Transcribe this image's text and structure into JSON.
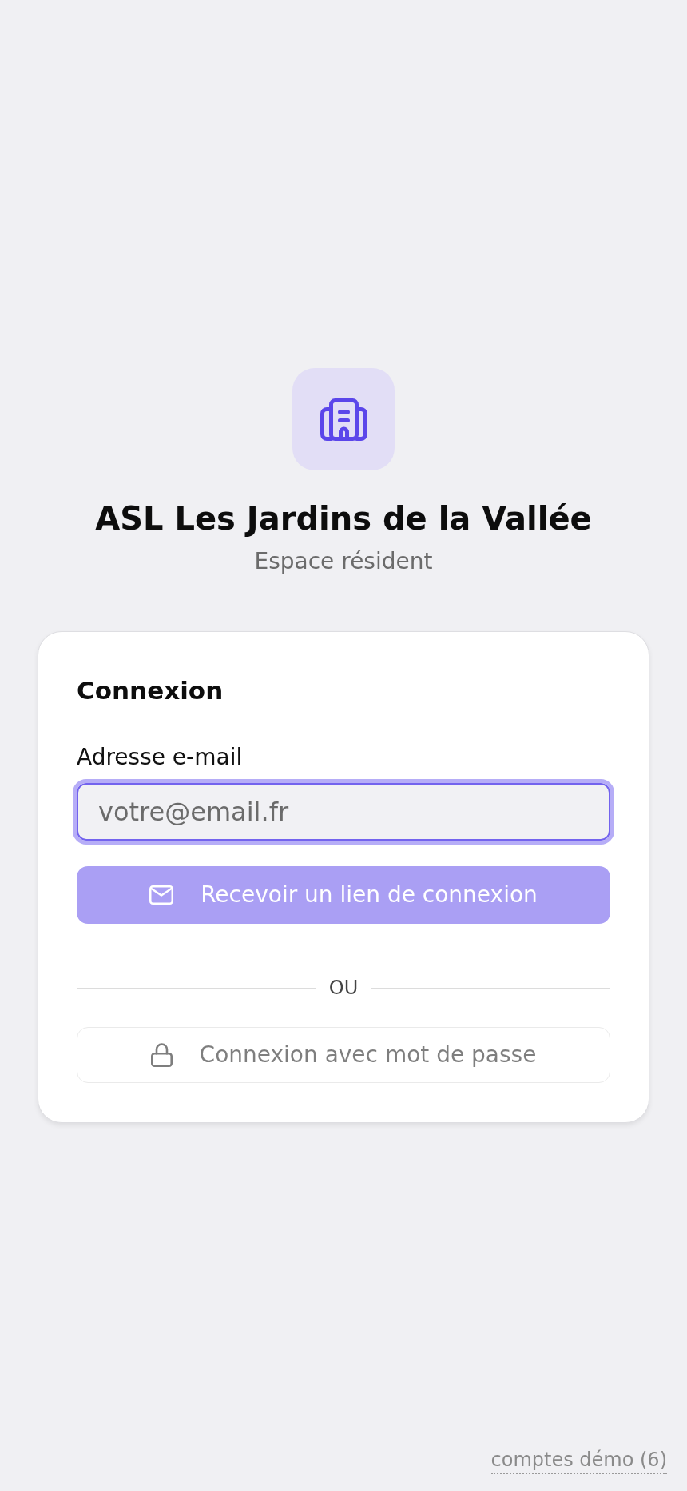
{
  "header": {
    "title": "ASL Les Jardins de la Vallée",
    "subtitle": "Espace résident"
  },
  "login_card": {
    "title": "Connexion",
    "email_field": {
      "label": "Adresse e-mail",
      "placeholder": "votre@email.fr",
      "focused": true
    },
    "magic_link_button": {
      "label": "Recevoir un lien de connexion",
      "disabled": true
    },
    "separator": "OU",
    "password_button": {
      "label": "Connexion avec mot de passe",
      "disabled": true
    }
  },
  "footer": {
    "demo_accounts_link": "comptes démo (6)"
  }
}
